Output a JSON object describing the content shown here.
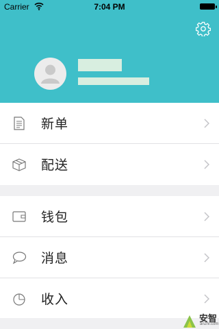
{
  "status_bar": {
    "carrier": "Carrier",
    "time": "7:04 PM"
  },
  "header": {
    "settings_icon": "gear-icon",
    "avatar_icon": "user-avatar-icon",
    "background": "#3fbfc9"
  },
  "menu": {
    "group1": [
      {
        "label": "新单",
        "icon": "document-icon"
      },
      {
        "label": "配送",
        "icon": "package-box-icon"
      }
    ],
    "group2": [
      {
        "label": "钱包",
        "icon": "wallet-icon"
      },
      {
        "label": "消息",
        "icon": "chat-bubble-icon"
      },
      {
        "label": "收入",
        "icon": "pie-chart-icon"
      }
    ]
  },
  "watermark": {
    "text": "安智",
    "sub": "anzhi.com"
  }
}
